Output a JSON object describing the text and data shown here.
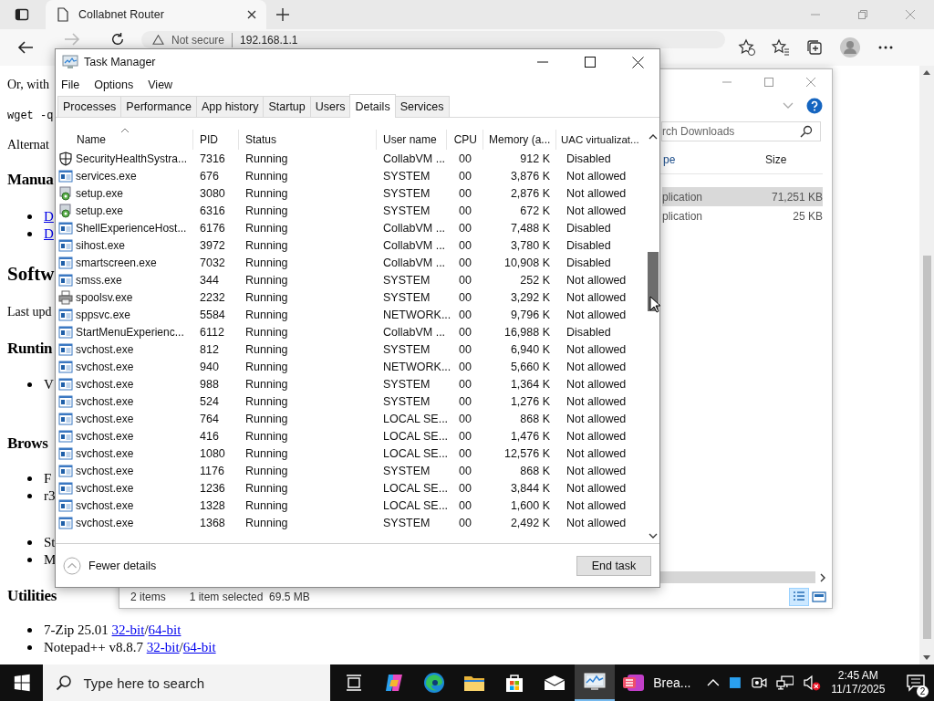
{
  "browser": {
    "tab": {
      "title": "Collabnet Router"
    },
    "address": {
      "security": "Not secure",
      "url": "192.168.1.1"
    }
  },
  "page": {
    "blocks": [
      {
        "kind": "p",
        "text": "Or, with"
      },
      {
        "kind": "code",
        "text": "wget -q"
      },
      {
        "kind": "p",
        "text": "Alternat"
      },
      {
        "kind": "h3",
        "text": "Manua"
      },
      {
        "kind": "links",
        "items": [
          "D",
          "D"
        ]
      },
      {
        "kind": "h2",
        "text": "Softw"
      },
      {
        "kind": "p",
        "text": "Last upd"
      },
      {
        "kind": "h3",
        "text": "Runtin"
      },
      {
        "kind": "list",
        "items": [
          "V"
        ]
      },
      {
        "kind": "h3",
        "text": "Brows"
      },
      {
        "kind": "list",
        "items": [
          "F",
          "r3"
        ]
      },
      {
        "kind": "list",
        "items": [
          "St",
          "M"
        ]
      },
      {
        "kind": "h3",
        "text": "Utilities"
      },
      {
        "kind": "downloads",
        "items": [
          {
            "text": "7-Zip 25.01 ",
            "links": [
              "32-bit",
              "64-bit"
            ],
            "sep": "/"
          },
          {
            "text": "Notepad++ v8.8.7 ",
            "links": [
              "32-bit",
              "64-bit"
            ],
            "sep": "/"
          }
        ]
      }
    ]
  },
  "explorer": {
    "search_placeholder": "rch Downloads",
    "columns": [
      "pe",
      "Size"
    ],
    "rows": [
      {
        "type": "plication",
        "size": "71,251 KB",
        "selected": true
      },
      {
        "type": "plication",
        "size": "25 KB",
        "selected": false
      }
    ],
    "status": {
      "items": "2 items",
      "selection": "1 item selected  69.5 MB"
    }
  },
  "task_manager": {
    "title": "Task Manager",
    "menu": [
      "File",
      "Options",
      "View"
    ],
    "tabs": [
      {
        "label": "Processes",
        "selected": false
      },
      {
        "label": "Performance",
        "selected": false
      },
      {
        "label": "App history",
        "selected": false
      },
      {
        "label": "Startup",
        "selected": false
      },
      {
        "label": "Users",
        "selected": false
      },
      {
        "label": "Details",
        "selected": true
      },
      {
        "label": "Services",
        "selected": false
      }
    ],
    "columns": [
      "Name",
      "PID",
      "Status",
      "User name",
      "CPU",
      "Memory (a...",
      "UAC virtualizat..."
    ],
    "rows": [
      {
        "kind": "shield",
        "name": "SecurityHealthSystra...",
        "pid": "7316",
        "status": "Running",
        "user": "CollabVM ...",
        "cpu": "00",
        "memory": "912 K",
        "uac": "Disabled"
      },
      {
        "kind": "app",
        "name": "services.exe",
        "pid": "676",
        "status": "Running",
        "user": "SYSTEM",
        "cpu": "00",
        "memory": "3,876 K",
        "uac": "Not allowed"
      },
      {
        "kind": "setup",
        "name": "setup.exe",
        "pid": "3080",
        "status": "Running",
        "user": "SYSTEM",
        "cpu": "00",
        "memory": "2,876 K",
        "uac": "Not allowed"
      },
      {
        "kind": "setup",
        "name": "setup.exe",
        "pid": "6316",
        "status": "Running",
        "user": "SYSTEM",
        "cpu": "00",
        "memory": "672 K",
        "uac": "Not allowed"
      },
      {
        "kind": "app",
        "name": "ShellExperienceHost...",
        "pid": "6176",
        "status": "Running",
        "user": "CollabVM ...",
        "cpu": "00",
        "memory": "7,488 K",
        "uac": "Disabled"
      },
      {
        "kind": "app",
        "name": "sihost.exe",
        "pid": "3972",
        "status": "Running",
        "user": "CollabVM ...",
        "cpu": "00",
        "memory": "3,780 K",
        "uac": "Disabled"
      },
      {
        "kind": "app",
        "name": "smartscreen.exe",
        "pid": "7032",
        "status": "Running",
        "user": "CollabVM ...",
        "cpu": "00",
        "memory": "10,908 K",
        "uac": "Disabled"
      },
      {
        "kind": "app",
        "name": "smss.exe",
        "pid": "344",
        "status": "Running",
        "user": "SYSTEM",
        "cpu": "00",
        "memory": "252 K",
        "uac": "Not allowed"
      },
      {
        "kind": "printer",
        "name": "spoolsv.exe",
        "pid": "2232",
        "status": "Running",
        "user": "SYSTEM",
        "cpu": "00",
        "memory": "3,292 K",
        "uac": "Not allowed"
      },
      {
        "kind": "app",
        "name": "sppsvc.exe",
        "pid": "5584",
        "status": "Running",
        "user": "NETWORK...",
        "cpu": "00",
        "memory": "9,796 K",
        "uac": "Not allowed"
      },
      {
        "kind": "app",
        "name": "StartMenuExperienc...",
        "pid": "6112",
        "status": "Running",
        "user": "CollabVM ...",
        "cpu": "00",
        "memory": "16,988 K",
        "uac": "Disabled"
      },
      {
        "kind": "app",
        "name": "svchost.exe",
        "pid": "812",
        "status": "Running",
        "user": "SYSTEM",
        "cpu": "00",
        "memory": "6,940 K",
        "uac": "Not allowed"
      },
      {
        "kind": "app",
        "name": "svchost.exe",
        "pid": "940",
        "status": "Running",
        "user": "NETWORK...",
        "cpu": "00",
        "memory": "5,660 K",
        "uac": "Not allowed"
      },
      {
        "kind": "app",
        "name": "svchost.exe",
        "pid": "988",
        "status": "Running",
        "user": "SYSTEM",
        "cpu": "00",
        "memory": "1,364 K",
        "uac": "Not allowed"
      },
      {
        "kind": "app",
        "name": "svchost.exe",
        "pid": "524",
        "status": "Running",
        "user": "SYSTEM",
        "cpu": "00",
        "memory": "1,276 K",
        "uac": "Not allowed"
      },
      {
        "kind": "app",
        "name": "svchost.exe",
        "pid": "764",
        "status": "Running",
        "user": "LOCAL SE...",
        "cpu": "00",
        "memory": "868 K",
        "uac": "Not allowed"
      },
      {
        "kind": "app",
        "name": "svchost.exe",
        "pid": "416",
        "status": "Running",
        "user": "LOCAL SE...",
        "cpu": "00",
        "memory": "1,476 K",
        "uac": "Not allowed"
      },
      {
        "kind": "app",
        "name": "svchost.exe",
        "pid": "1080",
        "status": "Running",
        "user": "LOCAL SE...",
        "cpu": "00",
        "memory": "12,576 K",
        "uac": "Not allowed"
      },
      {
        "kind": "app",
        "name": "svchost.exe",
        "pid": "1176",
        "status": "Running",
        "user": "SYSTEM",
        "cpu": "00",
        "memory": "868 K",
        "uac": "Not allowed"
      },
      {
        "kind": "app",
        "name": "svchost.exe",
        "pid": "1236",
        "status": "Running",
        "user": "LOCAL SE...",
        "cpu": "00",
        "memory": "3,844 K",
        "uac": "Not allowed"
      },
      {
        "kind": "app",
        "name": "svchost.exe",
        "pid": "1328",
        "status": "Running",
        "user": "LOCAL SE...",
        "cpu": "00",
        "memory": "1,600 K",
        "uac": "Not allowed"
      },
      {
        "kind": "app",
        "name": "svchost.exe",
        "pid": "1368",
        "status": "Running",
        "user": "SYSTEM",
        "cpu": "00",
        "memory": "2,492 K",
        "uac": "Not allowed"
      }
    ],
    "fewer_details": "Fewer details",
    "end_task": "End task"
  },
  "taskbar": {
    "search_placeholder": "Type here to search",
    "apps": [
      {
        "kind": "taskview",
        "selected": false
      },
      {
        "kind": "copilot",
        "selected": false
      },
      {
        "kind": "edge",
        "selected": false
      },
      {
        "kind": "folder",
        "selected": false
      },
      {
        "kind": "store",
        "selected": false
      },
      {
        "kind": "mail",
        "selected": false
      },
      {
        "kind": "taskmanager",
        "selected": true
      },
      {
        "kind": "labeled",
        "label": "Brea...",
        "selected": false
      }
    ],
    "clock": {
      "time": "2:45 AM",
      "date": "11/17/2025"
    },
    "notifications": "2"
  }
}
